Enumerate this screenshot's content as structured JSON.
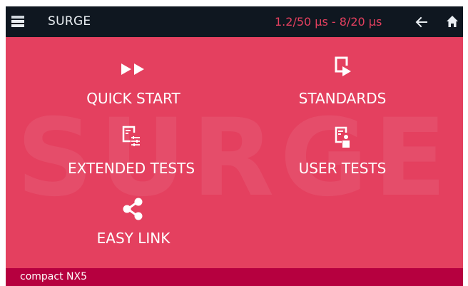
{
  "header": {
    "title": "SURGE",
    "waveform_label": "1.2/50 µs - 8/20 µs",
    "icons": {
      "menu": "menu-stack-icon",
      "back": "arrow-left-icon",
      "home": "home-icon"
    }
  },
  "watermark": "SURGE",
  "tiles": {
    "quick_start": {
      "label": "QUICK START",
      "icon": "fast-forward-icon"
    },
    "standards": {
      "label": "STANDARDS",
      "icon": "document-play-icon"
    },
    "extended_tests": {
      "label": "EXTENDED TESTS",
      "icon": "document-sliders-icon"
    },
    "user_tests": {
      "label": "USER TESTS",
      "icon": "document-user-icon"
    },
    "easy_link": {
      "label": "EASY LINK",
      "icon": "share-icon"
    }
  },
  "footer": {
    "device_name": "compact NX5"
  },
  "colors": {
    "background": "#e4405f",
    "header": "#0f1720",
    "footer": "#b6003f",
    "accent": "#e4405f",
    "text": "#ffffff"
  }
}
